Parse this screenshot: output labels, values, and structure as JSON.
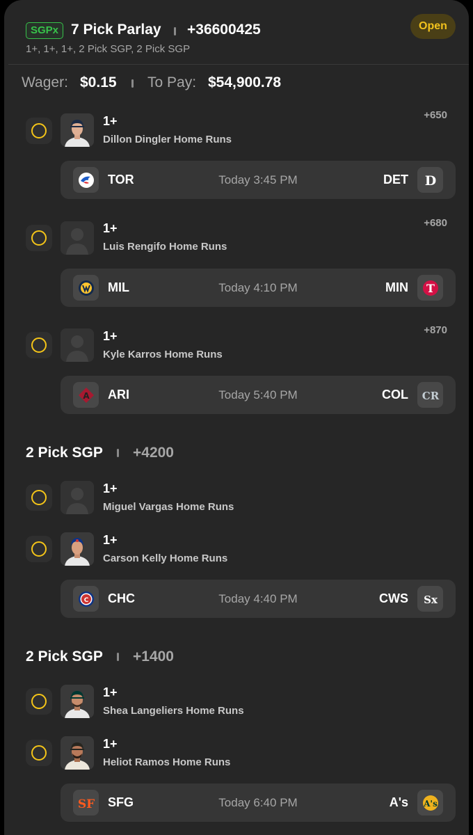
{
  "header": {
    "badge": "SGPx",
    "title": "7 Pick Parlay",
    "odds": "+36600425",
    "subtitle": "1+, 1+, 1+, 2 Pick SGP, 2 Pick SGP",
    "status": "Open",
    "wager_label": "Wager:",
    "wager_value": "$0.15",
    "topay_label": "To Pay:",
    "topay_value": "$54,900.78"
  },
  "legs": [
    {
      "line": "1+",
      "desc": "Dillon Dingler Home Runs",
      "odds": "+650",
      "game": {
        "away": "TOR",
        "time": "Today 3:45 PM",
        "home": "DET"
      }
    },
    {
      "line": "1+",
      "desc": "Luis Rengifo Home Runs",
      "odds": "+680",
      "game": {
        "away": "MIL",
        "time": "Today 4:10 PM",
        "home": "MIN"
      }
    },
    {
      "line": "1+",
      "desc": "Kyle Karros Home Runs",
      "odds": "+870",
      "game": {
        "away": "ARI",
        "time": "Today 5:40 PM",
        "home": "COL"
      }
    }
  ],
  "sgp1": {
    "title": "2 Pick SGP",
    "odds": "+4200",
    "legs": [
      {
        "line": "1+",
        "desc": "Miguel Vargas Home Runs"
      },
      {
        "line": "1+",
        "desc": "Carson Kelly Home Runs"
      }
    ],
    "game": {
      "away": "CHC",
      "time": "Today 4:40 PM",
      "home": "CWS"
    }
  },
  "sgp2": {
    "title": "2 Pick SGP",
    "odds": "+1400",
    "legs": [
      {
        "line": "1+",
        "desc": "Shea Langeliers Home Runs"
      },
      {
        "line": "1+",
        "desc": "Heliot Ramos Home Runs"
      }
    ],
    "game": {
      "away": "SFG",
      "time": "Today 6:40 PM",
      "home": "A's"
    }
  },
  "colors": {
    "background": "#262626",
    "game_row": "#363636",
    "sgpx_green": "#37c24a",
    "open_yellow": "#f2c21d",
    "radio_yellow": "#f5c518"
  }
}
